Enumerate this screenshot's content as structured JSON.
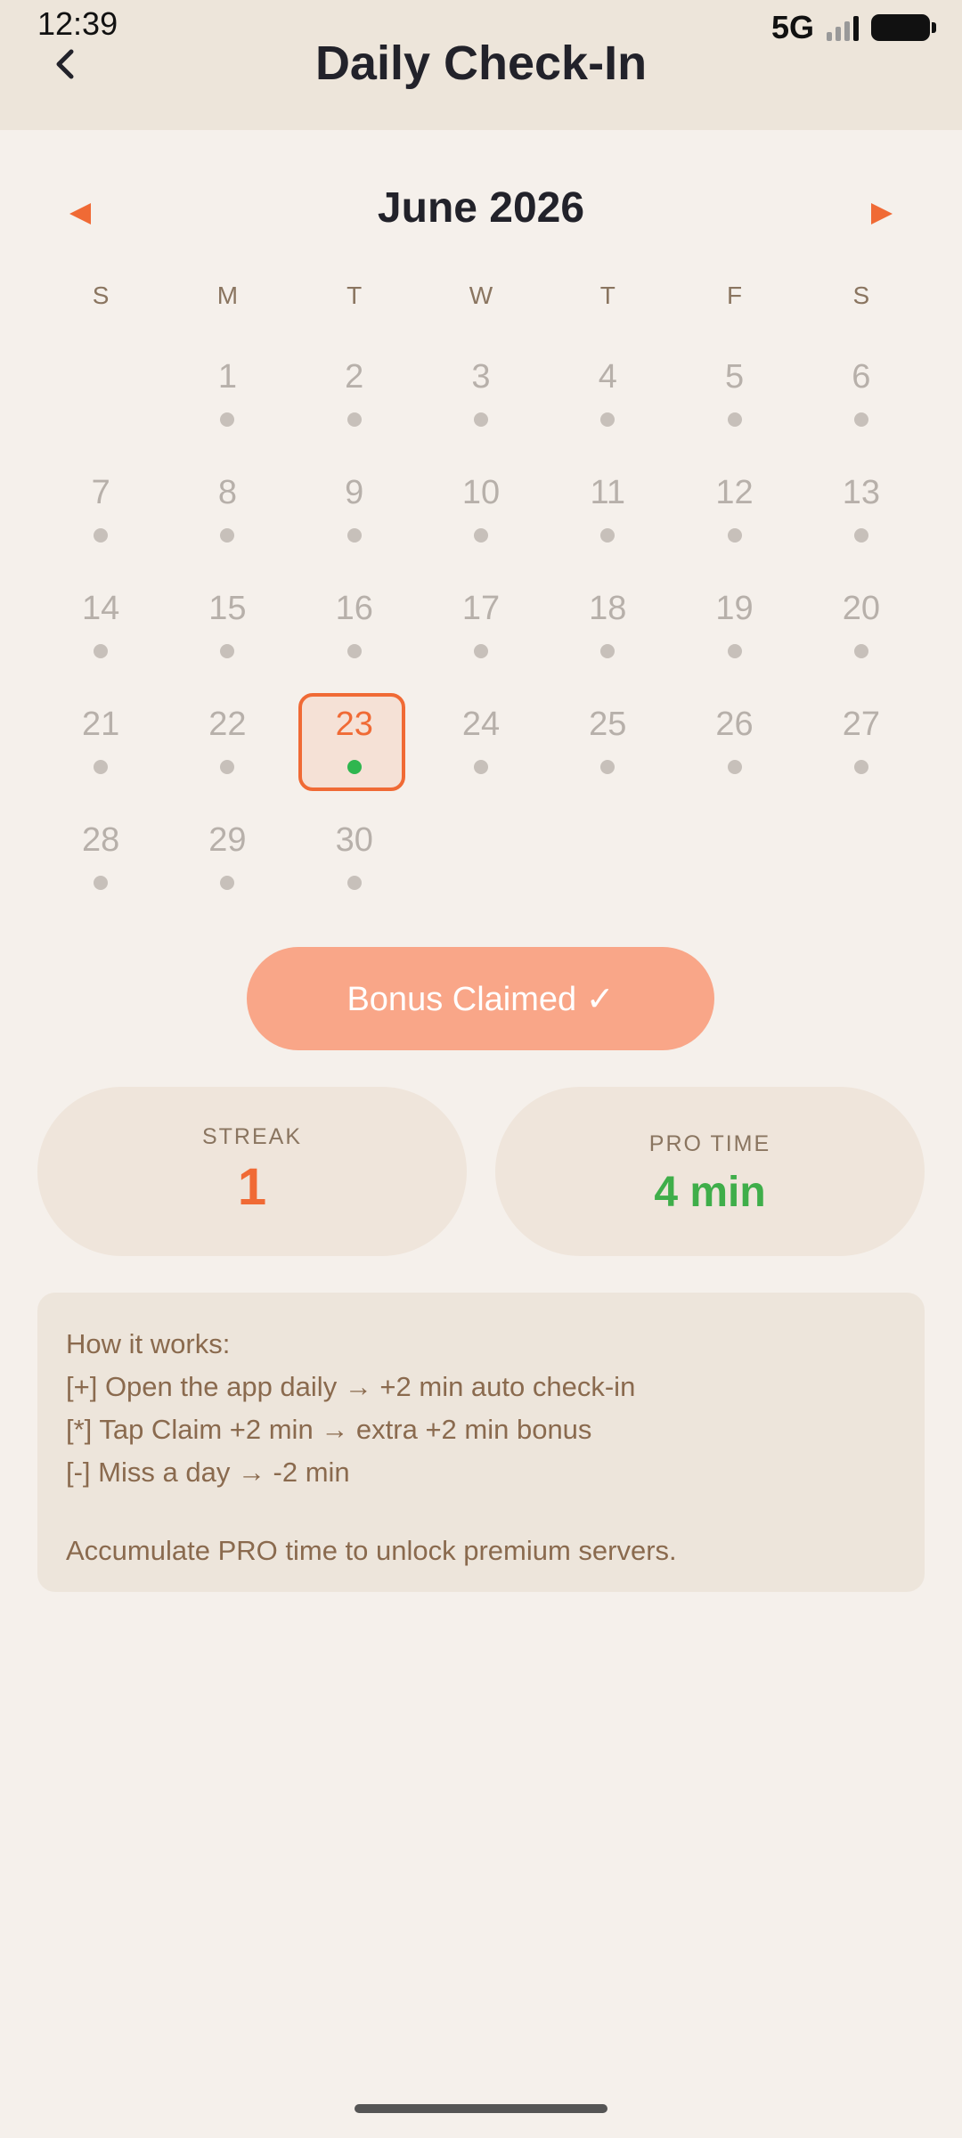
{
  "status_bar": {
    "time": "12:39",
    "network": "5G"
  },
  "header": {
    "title": "Daily Check-In",
    "back_icon": "chevron-left-icon"
  },
  "calendar": {
    "month_label": "June 2026",
    "prev_icon": "triangle-left-icon",
    "next_icon": "triangle-right-icon",
    "weekdays": [
      "S",
      "M",
      "T",
      "W",
      "T",
      "F",
      "S"
    ],
    "leading_blanks": 1,
    "days": [
      "1",
      "2",
      "3",
      "4",
      "5",
      "6",
      "7",
      "8",
      "9",
      "10",
      "11",
      "12",
      "13",
      "14",
      "15",
      "16",
      "17",
      "18",
      "19",
      "20",
      "21",
      "22",
      "23",
      "24",
      "25",
      "26",
      "27",
      "28",
      "29",
      "30"
    ],
    "today": "23",
    "colors": {
      "accent": "#f06a35",
      "checked_dot": "#2fb64f",
      "dot": "#c7c0ba"
    }
  },
  "bonus": {
    "label": "Bonus Claimed ✓"
  },
  "stats": {
    "streak_label": "STREAK",
    "streak_value": "1",
    "pro_label": "PRO TIME",
    "pro_value": "4 min"
  },
  "info": {
    "heading": "How it works:",
    "lines": [
      "[+] Open the app daily → +2 min auto check-in",
      "[*] Tap Claim +2 min → extra +2 min bonus",
      "[-] Miss a day → -2 min"
    ],
    "footer": "Accumulate PRO time to unlock premium servers."
  }
}
